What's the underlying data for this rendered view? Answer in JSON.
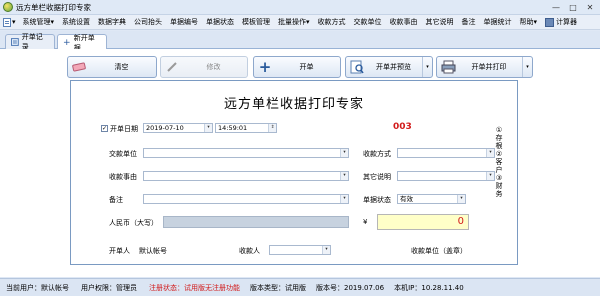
{
  "window": {
    "title": "远方单栏收据打印专家",
    "buttons": [
      "—",
      "□",
      "✕"
    ]
  },
  "menu": [
    "系统管理",
    "系统设置",
    "数据字典",
    "公司抬头",
    "单据编号",
    "单据状态",
    "模板管理",
    "批量操作",
    "收款方式",
    "交款单位",
    "收款事由",
    "其它说明",
    "备注",
    "单据统计",
    "帮助",
    "计算器"
  ],
  "menu_arrow": "▾",
  "tabs": [
    {
      "label": "开单记录"
    },
    {
      "label": "新开单据"
    }
  ],
  "toolbar": {
    "clear": "清空",
    "edit": "修改",
    "open": "开单",
    "open_preview": "开单并预览",
    "open_print": "开单并打印"
  },
  "form": {
    "title": "远方单栏收据打印专家",
    "date_label": "开单日期",
    "date": "2019-07-10",
    "time": "14:59:01",
    "number": "003",
    "payer_label": "交款单位",
    "method_label": "收款方式",
    "reason_label": "收款事由",
    "other_label": "其它说明",
    "note_label": "备注",
    "status_label": "单据状态",
    "status_value": "有效",
    "rmb_label": "人民币（大写）",
    "yen": "¥",
    "amount": "0",
    "issuer_label": "开单人",
    "issuer_value": "默认帐号",
    "payee_label": "收款人",
    "stamp_label": "收款单位（盖章）"
  },
  "side_note": "①存根②客户③财务",
  "status": {
    "current_user": "当前用户：默认帐号",
    "permission": "用户权限：管理员",
    "reg_status": "注册状态：试用版无注册功能",
    "edition": "版本类型：试用版",
    "version": "版本号：2019.07.06",
    "ip": "本机IP：10.28.11.40"
  },
  "colors": {
    "accent_red": "#d21a1a",
    "amount_bg": "#ffffc8"
  }
}
